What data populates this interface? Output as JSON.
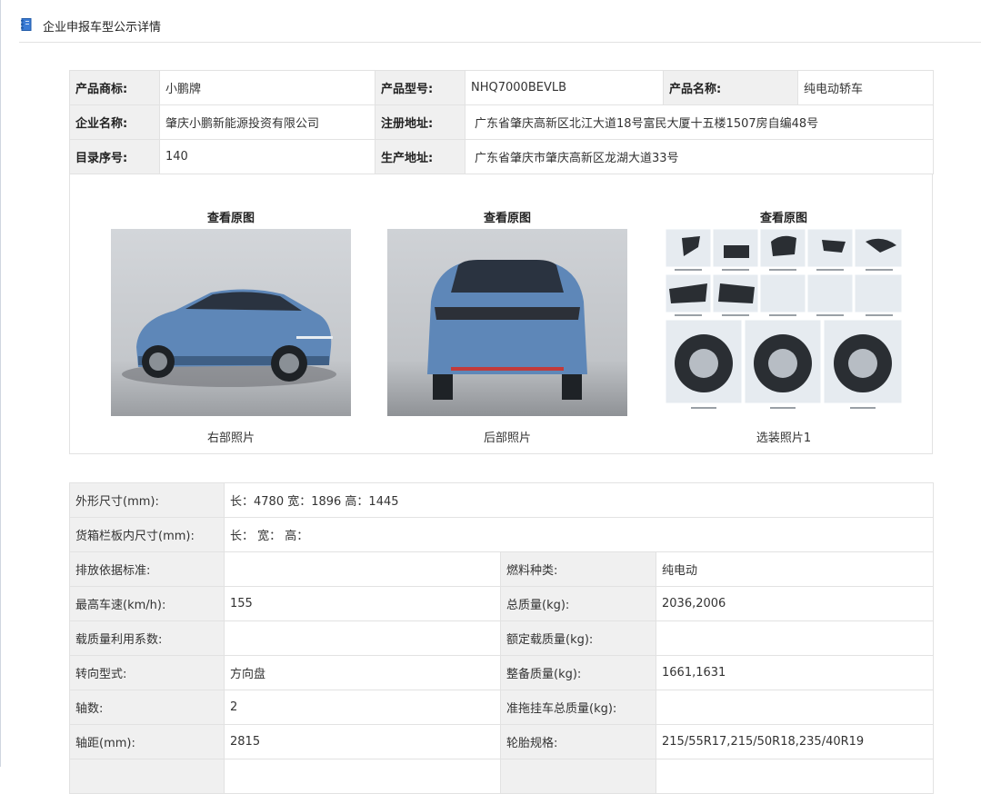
{
  "header": {
    "title": "企业申报车型公示详情",
    "icon": "notebook-icon"
  },
  "info": {
    "rows": [
      [
        {
          "label": "产品商标:",
          "value": "小鹏牌"
        },
        {
          "label": "产品型号:",
          "value": "NHQ7000BEVLB"
        },
        {
          "label": "产品名称:",
          "value": "纯电动轿车"
        }
      ],
      [
        {
          "label": "企业名称:",
          "value": "肇庆小鹏新能源投资有限公司"
        },
        {
          "label": "注册地址:",
          "value": "广东省肇庆高新区北江大道18号富民大厦十五楼1507房自编48号"
        }
      ],
      [
        {
          "label": "目录序号:",
          "value": "140"
        },
        {
          "label": "生产地址:",
          "value": "广东省肇庆市肇庆高新区龙湖大道33号"
        }
      ]
    ]
  },
  "photos": [
    {
      "view": "查看原图",
      "caption": "右部照片"
    },
    {
      "view": "查看原图",
      "caption": "后部照片"
    },
    {
      "view": "查看原图",
      "caption": "选装照片1"
    }
  ],
  "specs": {
    "full_rows": [
      {
        "label": "外形尺寸(mm):",
        "value": "长：4780 宽：1896 高：1445"
      },
      {
        "label": "货箱栏板内尺寸(mm):",
        "value": "长：  宽：  高："
      }
    ],
    "rows": [
      {
        "l1": "排放依据标准:",
        "v1": "",
        "l2": "燃料种类:",
        "v2": "纯电动"
      },
      {
        "l1": "最高车速(km/h):",
        "v1": "155",
        "l2": "总质量(kg):",
        "v2": "2036,2006"
      },
      {
        "l1": "载质量利用系数:",
        "v1": "",
        "l2": "额定载质量(kg):",
        "v2": ""
      },
      {
        "l1": "转向型式:",
        "v1": "方向盘",
        "l2": "整备质量(kg):",
        "v2": "1661,1631"
      },
      {
        "l1": "轴数:",
        "v1": "2",
        "l2": "准拖挂车总质量(kg):",
        "v2": ""
      },
      {
        "l1": "轴距(mm):",
        "v1": "2815",
        "l2": "轮胎规格:",
        "v2": "215/55R17,215/50R18,235/40R19"
      }
    ]
  },
  "colors": {
    "car_body": "#5e87b8",
    "background": "#ffffff",
    "label_bg": "#f0f0f0",
    "border": "#e2e2e2"
  }
}
